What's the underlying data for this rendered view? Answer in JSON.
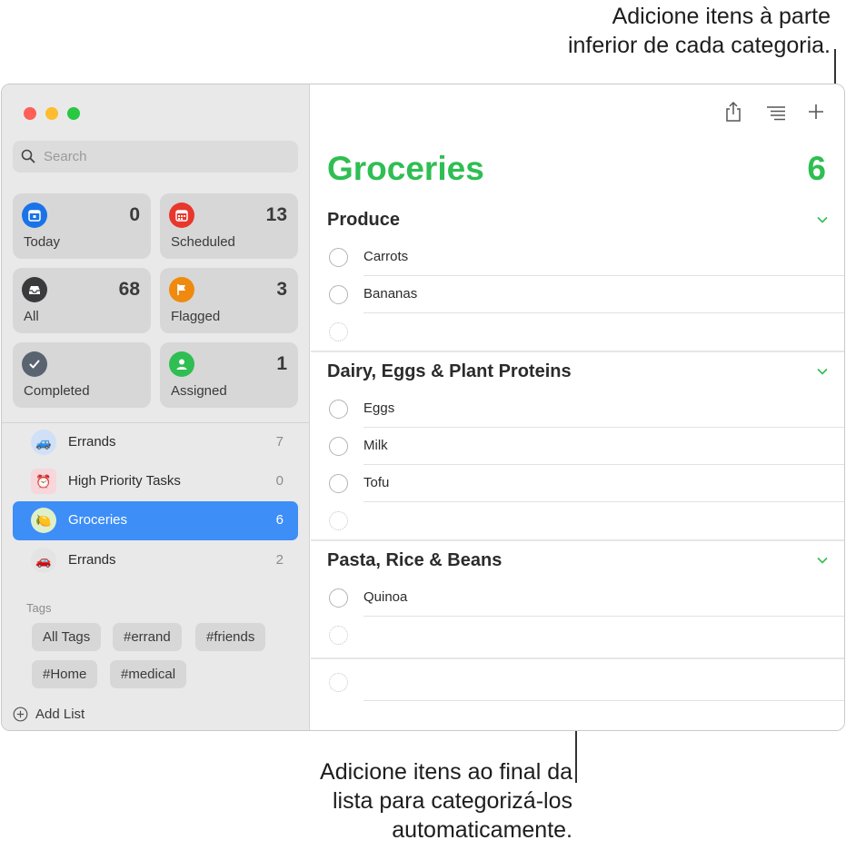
{
  "callouts": {
    "top_line1": "Adicione itens à parte",
    "top_line2": "inferior de cada categoria.",
    "bottom_line1": "Adicione itens ao final da",
    "bottom_line2": "lista para categorizá-los",
    "bottom_line3": "automaticamente."
  },
  "sidebar": {
    "search_placeholder": "Search",
    "smart_lists": [
      {
        "label": "Today",
        "count": "0",
        "color": "#1a73e8",
        "icon": "calendar-today-icon"
      },
      {
        "label": "Scheduled",
        "count": "13",
        "color": "#e8372c",
        "icon": "calendar-grid-icon"
      },
      {
        "label": "All",
        "count": "68",
        "color": "#3a3a3c",
        "icon": "tray-icon"
      },
      {
        "label": "Flagged",
        "count": "3",
        "color": "#f08a0e",
        "icon": "flag-icon"
      },
      {
        "label": "Completed",
        "count": "",
        "color": "#5a6370",
        "icon": "checkmark-icon"
      },
      {
        "label": "Assigned",
        "count": "1",
        "color": "#2fbe52",
        "icon": "person-icon"
      }
    ],
    "lists": [
      {
        "name": "Errands",
        "count": "7",
        "icon": "car-icon"
      },
      {
        "name": "High Priority Tasks",
        "count": "0",
        "icon": "alarm-clock-icon"
      },
      {
        "name": "Groceries",
        "count": "6",
        "icon": "lemon-icon"
      },
      {
        "name": "Errands",
        "count": "2",
        "icon": "red-car-icon"
      }
    ],
    "tags_label": "Tags",
    "tags": [
      "All Tags",
      "#errand",
      "#friends",
      "#Home",
      "#medical"
    ],
    "add_list": "Add List"
  },
  "main": {
    "title": "Groceries",
    "count": "6",
    "accent": "#2fbe52",
    "sections": [
      {
        "title": "Produce",
        "items": [
          "Carrots",
          "Bananas"
        ]
      },
      {
        "title": "Dairy, Eggs & Plant Proteins",
        "items": [
          "Eggs",
          "Milk",
          "Tofu"
        ]
      },
      {
        "title": "Pasta, Rice & Beans",
        "items": [
          "Quinoa"
        ]
      }
    ]
  }
}
